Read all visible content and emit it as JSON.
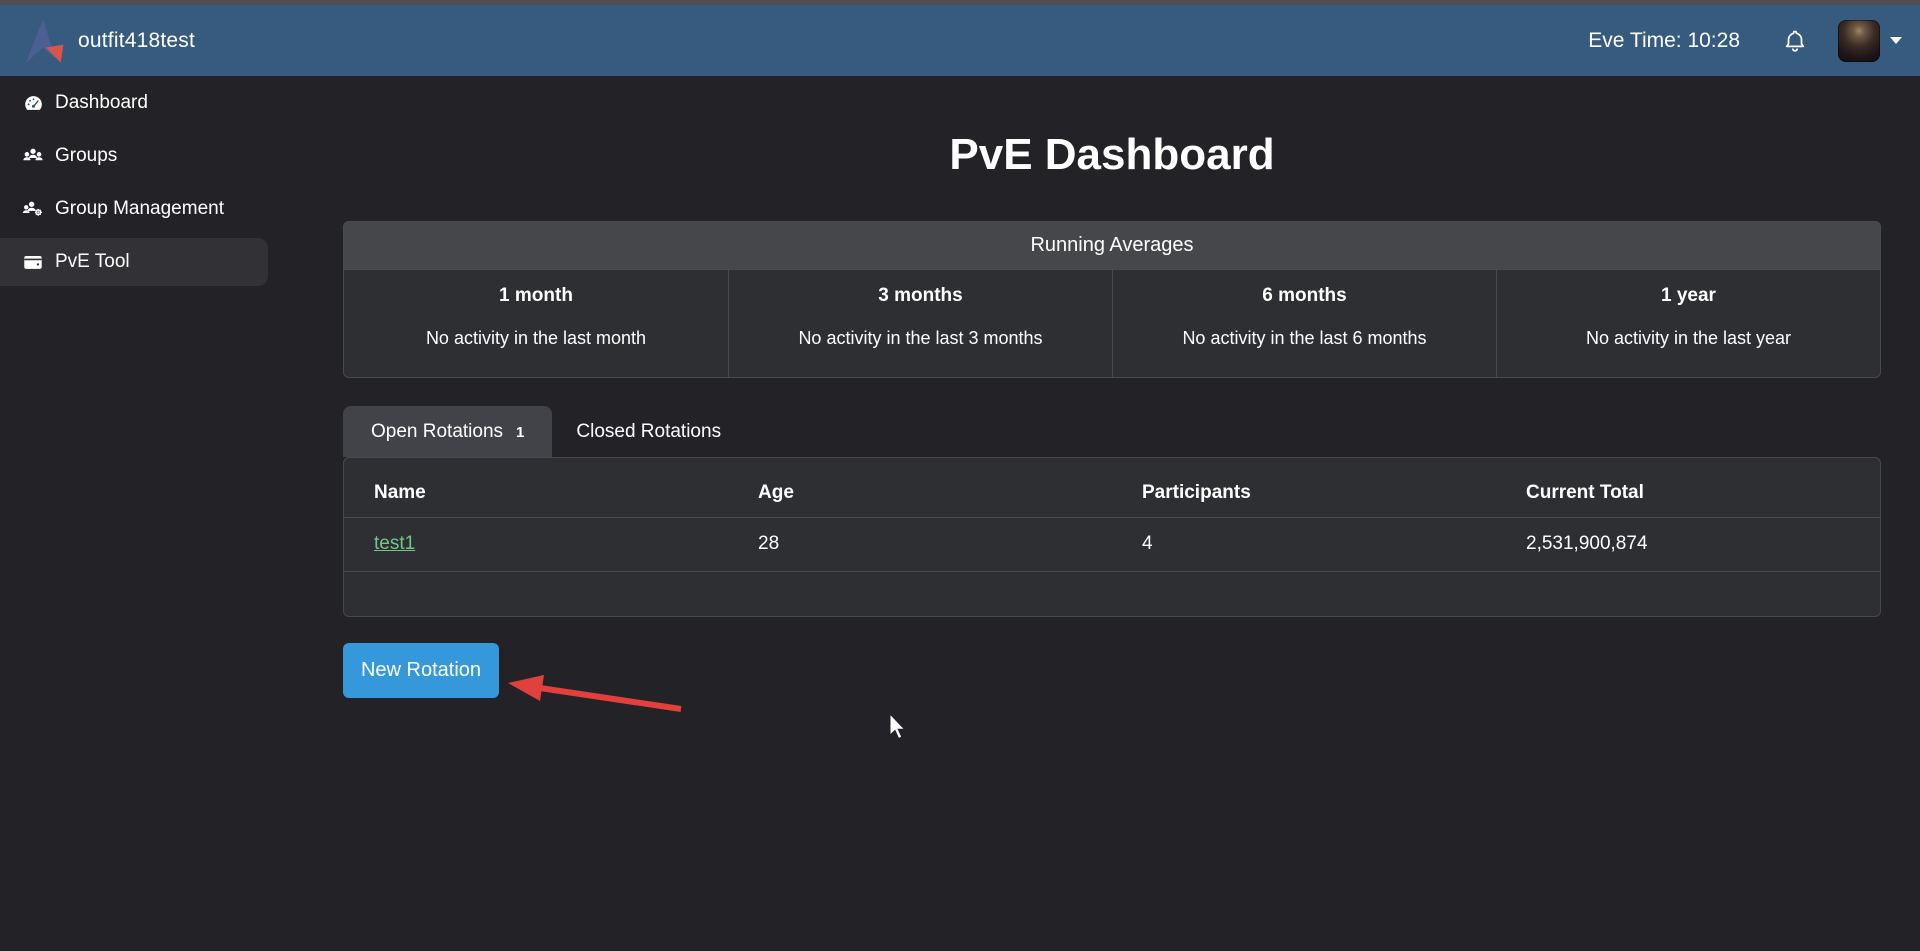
{
  "navbar": {
    "brand": "outfit418test",
    "eve_time": "Eve Time: 10:28"
  },
  "sidebar": {
    "items": [
      {
        "label": "Dashboard",
        "icon": "dashboard-gauge-icon",
        "active": false
      },
      {
        "label": "Groups",
        "icon": "users-icon",
        "active": false
      },
      {
        "label": "Group Management",
        "icon": "users-gear-icon",
        "active": false
      },
      {
        "label": "PvE Tool",
        "icon": "wallet-icon",
        "active": true
      }
    ]
  },
  "main": {
    "title": "PvE Dashboard",
    "running_averages": {
      "header": "Running Averages",
      "columns": [
        {
          "period": "1 month",
          "status": "No activity in the last month"
        },
        {
          "period": "3 months",
          "status": "No activity in the last 3 months"
        },
        {
          "period": "6 months",
          "status": "No activity in the last 6 months"
        },
        {
          "period": "1 year",
          "status": "No activity in the last year"
        }
      ]
    },
    "tabs": [
      {
        "label": "Open Rotations",
        "badge": "1",
        "active": true
      },
      {
        "label": "Closed Rotations",
        "active": false
      }
    ],
    "rotations_table": {
      "headers": [
        "Name",
        "Age",
        "Participants",
        "Current Total"
      ],
      "rows": [
        {
          "name": "test1",
          "age": "28",
          "participants": "4",
          "current_total": "2,531,900,874"
        }
      ]
    },
    "new_rotation_button": "New Rotation"
  },
  "annotations": {
    "arrow_icon": "red-annotation-arrow",
    "cursor_icon": "mouse-pointer"
  },
  "colors": {
    "navbar_bg": "#375a7f",
    "page_bg": "#232327",
    "card_bg": "#2e2f33",
    "card_header_bg": "#46474b",
    "active_sidebar_bg": "#313136",
    "button_blue": "#3498db",
    "link_green": "#74c687",
    "arrow_red": "#e2403c"
  }
}
